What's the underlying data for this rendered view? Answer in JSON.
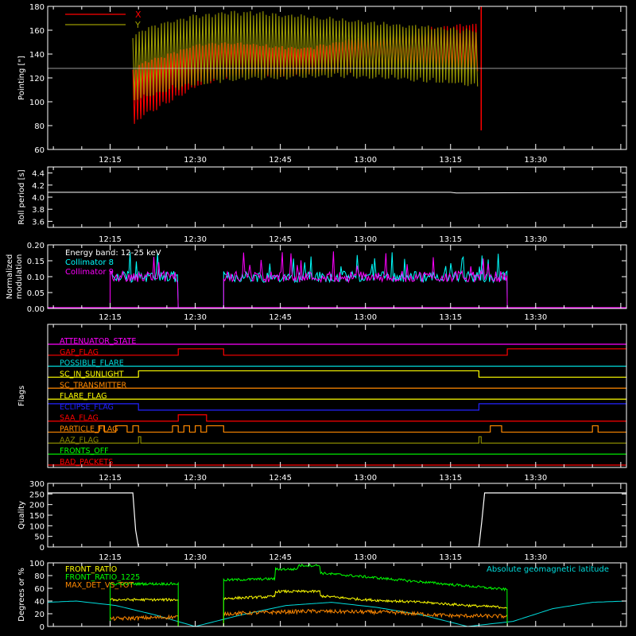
{
  "chart_data": [
    {
      "type": "line",
      "ylabel": "Pointing [\"]",
      "ylim": [
        60,
        180
      ],
      "yticks": [
        60,
        80,
        100,
        120,
        140,
        160,
        180
      ],
      "xlim": [
        "12:04",
        "13:46"
      ],
      "xticks": [
        "12:15",
        "12:30",
        "12:45",
        "13:00",
        "13:15",
        "13:30"
      ],
      "ref_line": 128,
      "legend": "top-left",
      "series": [
        {
          "name": "X",
          "color": "#ff0000",
          "x": [
            "12:19",
            "12:21",
            "12:25",
            "12:30",
            "12:35",
            "12:40",
            "12:45",
            "12:50",
            "12:55",
            "13:00",
            "13:05",
            "13:10",
            "13:15",
            "13:20"
          ],
          "lower": [
            78,
            88,
            98,
            112,
            120,
            122,
            120,
            122,
            124,
            124,
            126,
            126,
            127,
            124
          ],
          "upper": [
            128,
            134,
            140,
            148,
            150,
            149,
            146,
            146,
            150,
            156,
            160,
            162,
            164,
            166
          ]
        },
        {
          "name": "Y",
          "color": "#999900",
          "x": [
            "12:19",
            "12:21",
            "12:25",
            "12:30",
            "12:35",
            "12:40",
            "12:45",
            "12:50",
            "12:55",
            "13:00",
            "13:05",
            "13:10",
            "13:15",
            "13:20"
          ],
          "lower": [
            100,
            102,
            108,
            114,
            117,
            118,
            119,
            120,
            121,
            120,
            119,
            117,
            115,
            112
          ],
          "upper": [
            156,
            162,
            168,
            173,
            176,
            176,
            174,
            172,
            170,
            168,
            166,
            164,
            162,
            160
          ]
        }
      ]
    },
    {
      "type": "line",
      "ylabel": "Roll period [s]",
      "ylim": [
        3.5,
        4.5
      ],
      "yticks": [
        3.6,
        3.8,
        4.0,
        4.2,
        4.4
      ],
      "xlim": [
        "12:04",
        "13:46"
      ],
      "xticks": [
        "12:15",
        "12:30",
        "12:45",
        "13:00",
        "13:15",
        "13:30"
      ],
      "series": [
        {
          "name": "",
          "color": "#ffffff",
          "x": [
            "12:04",
            "13:15",
            "13:16",
            "13:46"
          ],
          "values": [
            4.08,
            4.08,
            4.07,
            4.08
          ]
        }
      ]
    },
    {
      "type": "line",
      "ylabel": "Normalized modulation",
      "ylim": [
        0,
        0.2
      ],
      "yticks": [
        0.0,
        0.05,
        0.1,
        0.15,
        0.2
      ],
      "xlim": [
        "12:04",
        "13:46"
      ],
      "xticks": [
        "12:15",
        "12:30",
        "12:45",
        "13:00",
        "13:15",
        "13:30"
      ],
      "legend": "top-left",
      "annotation": "Energy band: 12-25 keV",
      "segments": [
        [
          "12:15",
          "12:27"
        ],
        [
          "12:35",
          "13:25"
        ]
      ],
      "series": [
        {
          "name": "Collimator 8",
          "color": "#00ffff",
          "mean": 0.1
        },
        {
          "name": "Collimator 9",
          "color": "#ff00ff",
          "mean": 0.1
        }
      ]
    },
    {
      "type": "line",
      "ylabel": "Flags",
      "xlim": [
        "12:04",
        "13:46"
      ],
      "xticks": [
        "12:15",
        "12:30",
        "12:45",
        "13:00",
        "13:15",
        "13:30"
      ],
      "flags": [
        {
          "name": "ATTENUATOR_STATE",
          "color": "#ff00ff",
          "on": []
        },
        {
          "name": "GAP_FLAG",
          "color": "#ff0000",
          "on": [
            [
              "12:27",
              "12:35"
            ],
            [
              "13:25",
              "13:46"
            ]
          ]
        },
        {
          "name": "POSSIBLE_FLARE",
          "color": "#00dddd",
          "on": []
        },
        {
          "name": "SC_IN_SUNLIGHT",
          "color": "#ffff00",
          "on": [
            [
              "12:20",
              "13:20"
            ]
          ]
        },
        {
          "name": "SC_TRANSMITTER",
          "color": "#ff8800",
          "on": []
        },
        {
          "name": "FLARE_FLAG",
          "color": "#ffff00",
          "on": []
        },
        {
          "name": "ECLIPSE_FLAG",
          "color": "#2222ff",
          "on": [
            [
              "12:04",
              "12:20"
            ],
            [
              "13:20",
              "13:46"
            ]
          ]
        },
        {
          "name": "SAA_FLAG",
          "color": "#ff0000",
          "on": [
            [
              "12:27",
              "12:32"
            ]
          ]
        },
        {
          "name": "PARTICLE_FLAG",
          "color": "#ff8800",
          "on": [
            [
              "12:13",
              "12:14"
            ],
            [
              "12:16",
              "12:18"
            ],
            [
              "12:19",
              "12:20"
            ],
            [
              "12:26",
              "12:27"
            ],
            [
              "12:28",
              "12:29"
            ],
            [
              "12:30",
              "12:31"
            ],
            [
              "12:32",
              "12:35"
            ],
            [
              "13:22",
              "13:24"
            ],
            [
              "13:40",
              "13:41"
            ]
          ]
        },
        {
          "name": "AAZ_FLAG",
          "color": "#888800",
          "on": [
            [
              "12:20",
              "12:20.4"
            ],
            [
              "13:20",
              "13:20.4"
            ]
          ]
        },
        {
          "name": "FRONTS_OFF",
          "color": "#00ff00",
          "on": []
        },
        {
          "name": "BAD_PACKETS",
          "color": "#ff0000",
          "on": []
        }
      ]
    },
    {
      "type": "line",
      "ylabel": "Quality",
      "ylim": [
        0,
        300
      ],
      "yticks": [
        0,
        50,
        100,
        150,
        200,
        250,
        300
      ],
      "xlim": [
        "12:04",
        "13:46"
      ],
      "xticks": [
        "12:15",
        "12:30",
        "12:45",
        "13:00",
        "13:15",
        "13:30"
      ],
      "series": [
        {
          "name": "",
          "color": "#ffffff",
          "x": [
            "12:04",
            "12:19",
            "12:19.5",
            "12:20",
            "13:20",
            "13:20.5",
            "13:21",
            "13:46"
          ],
          "values": [
            255,
            255,
            80,
            0,
            0,
            120,
            255,
            255
          ]
        }
      ]
    },
    {
      "type": "line",
      "ylabel": "Degrees or %",
      "ylim": [
        0,
        100
      ],
      "yticks": [
        0,
        20,
        40,
        60,
        80,
        100
      ],
      "xlim": [
        "12:04",
        "13:46"
      ],
      "xticks": [
        "12:15",
        "12:30",
        "12:45",
        "13:00",
        "13:15",
        "13:30"
      ],
      "legend": "top-left",
      "series": [
        {
          "name": "FRONT_RATIO",
          "color": "#ffff00",
          "x": [
            "12:15",
            "12:27",
            "12:35",
            "12:44",
            "12:44.1",
            "12:52",
            "12:52.1",
            "13:00",
            "13:10",
            "13:20",
            "13:25"
          ],
          "values": [
            42,
            42,
            44,
            47,
            55,
            55,
            48,
            42,
            38,
            32,
            30
          ]
        },
        {
          "name": "FRONT_RATIO_1225",
          "color": "#00ff00",
          "x": [
            "12:15",
            "12:27",
            "12:35",
            "12:44",
            "12:44.1",
            "12:48",
            "12:48.1",
            "12:52",
            "12:52.1",
            "13:00",
            "13:10",
            "13:20",
            "13:25"
          ],
          "values": [
            67,
            67,
            73,
            75,
            90,
            90,
            96,
            96,
            84,
            78,
            70,
            62,
            58
          ]
        },
        {
          "name": "MAX_DET_VS_TOT",
          "color": "#ff8800",
          "x": [
            "12:15",
            "12:27",
            "12:35",
            "12:50",
            "13:05",
            "13:15",
            "13:25"
          ],
          "values": [
            12,
            15,
            20,
            24,
            22,
            17,
            16
          ]
        },
        {
          "name": "Absolute geomagnetic latitude",
          "color": "#00dddd",
          "x": [
            "12:04",
            "12:09",
            "12:16",
            "12:23",
            "12:30",
            "12:38",
            "12:46",
            "12:54",
            "13:02",
            "13:10",
            "13:18",
            "13:26",
            "13:33",
            "13:40",
            "13:46"
          ],
          "values": [
            38,
            40,
            33,
            18,
            0,
            18,
            33,
            38,
            30,
            18,
            0,
            8,
            28,
            38,
            40
          ]
        }
      ]
    }
  ]
}
